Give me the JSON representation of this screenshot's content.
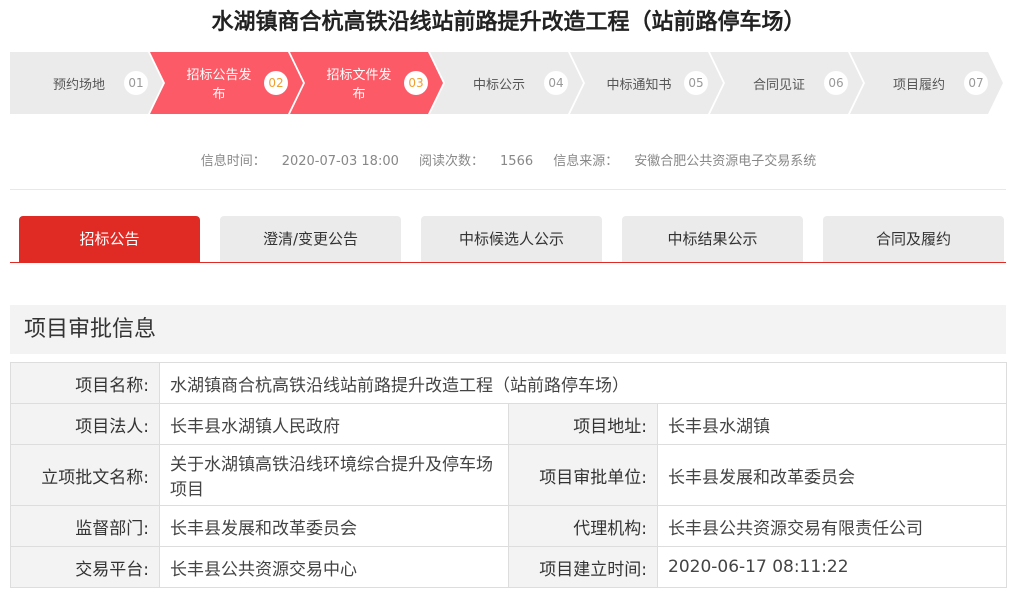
{
  "title": "水湖镇商合杭高铁沿线站前路提升改造工程（站前路停车场）",
  "steps": [
    {
      "label": "预约场地",
      "num": "01",
      "active": false
    },
    {
      "label": "招标公告发布",
      "num": "02",
      "active": true
    },
    {
      "label": "招标文件发布",
      "num": "03",
      "active": true
    },
    {
      "label": "中标公示",
      "num": "04",
      "active": false
    },
    {
      "label": "中标通知书",
      "num": "05",
      "active": false
    },
    {
      "label": "合同见证",
      "num": "06",
      "active": false
    },
    {
      "label": "项目履约",
      "num": "07",
      "active": false
    }
  ],
  "meta": {
    "time_label": "信息时间：",
    "time": "2020-07-03 18:00",
    "reads_label": "阅读次数：",
    "reads": "1566",
    "source_label": "信息来源：",
    "source": "安徽合肥公共资源电子交易系统"
  },
  "tabs": [
    "招标公告",
    "澄清/变更公告",
    "中标候选人公示",
    "中标结果公示",
    "合同及履约"
  ],
  "section_title": "项目审批信息",
  "table": {
    "name_k": "项目名称:",
    "name_v": "水湖镇商合杭高铁沿线站前路提升改造工程（站前路停车场）",
    "legal_k": "项目法人:",
    "legal_v": "长丰县水湖镇人民政府",
    "addr_k": "项目地址:",
    "addr_v": "长丰县水湖镇",
    "doc_k": "立项批文名称:",
    "doc_v": "关于水湖镇高铁沿线环境综合提升及停车场项目",
    "unit_k": "项目审批单位:",
    "unit_v": "长丰县发展和改革委员会",
    "sup_k": "监督部门:",
    "sup_v": "长丰县发展和改革委员会",
    "agent_k": "代理机构:",
    "agent_v": "长丰县公共资源交易有限责任公司",
    "plat_k": "交易平台:",
    "plat_v": "长丰县公共资源交易中心",
    "created_k": "项目建立时间:",
    "created_v": "2020-06-17 08:11:22"
  },
  "colors": {
    "accent": "#e02a24",
    "step_active": "#fb5a66"
  }
}
